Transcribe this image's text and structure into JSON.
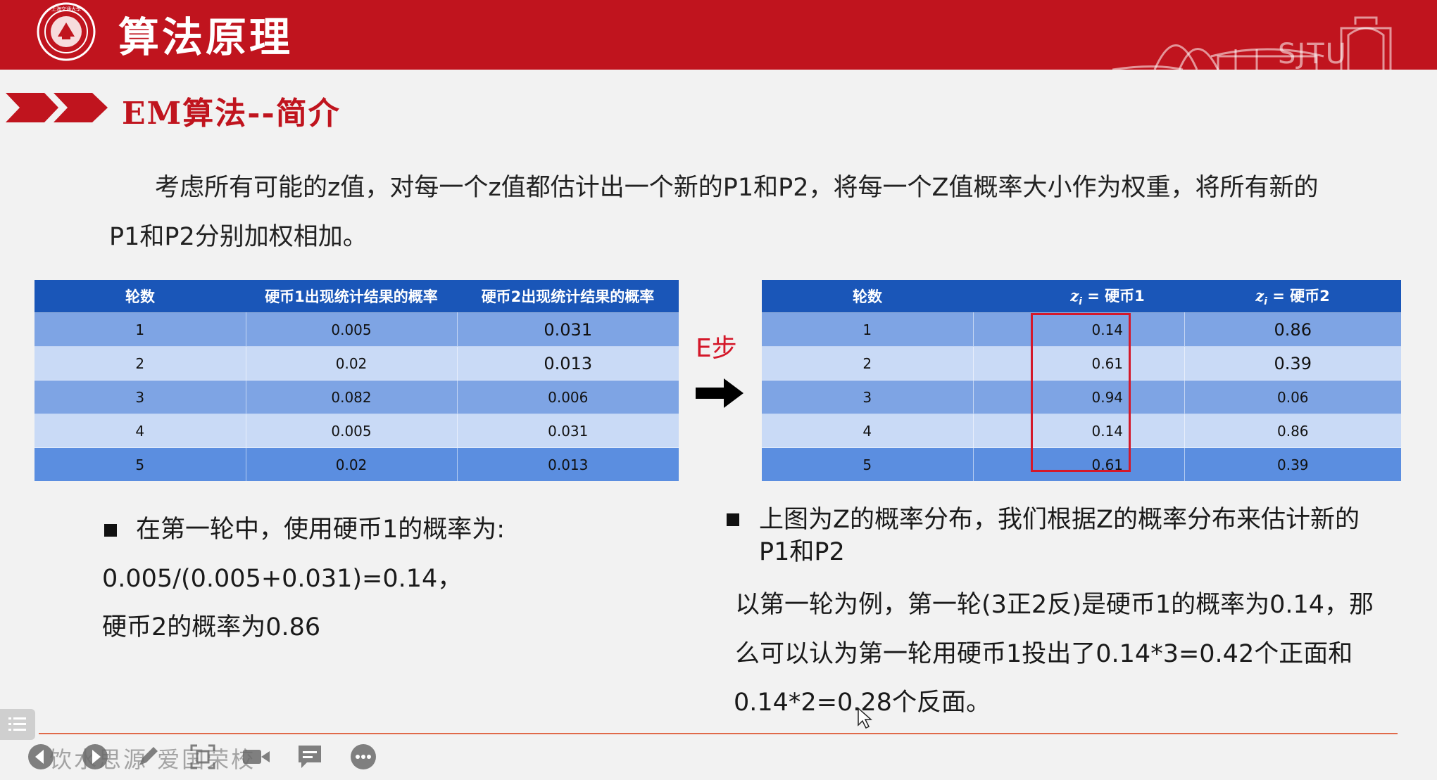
{
  "header": {
    "title": "算法原理",
    "logo_text": "上海交通大学",
    "brand_mark": "SJTU",
    "color": "#c0141e"
  },
  "section": {
    "title": "EM算法--简介"
  },
  "intro": {
    "text": "考虑所有可能的z值，对每一个z值都估计出一个新的P1和P2，将每一个Z值概率大小作为权重，将所有新的P1和P2分别加权相加。"
  },
  "table_left": {
    "headers": [
      "轮数",
      "硬币1出现统计结果的概率",
      "硬币2出现统计结果的概率"
    ],
    "rows": [
      [
        "1",
        "0.005",
        "0.031"
      ],
      [
        "2",
        "0.02",
        "0.013"
      ],
      [
        "3",
        "0.082",
        "0.006"
      ],
      [
        "4",
        "0.005",
        "0.031"
      ],
      [
        "5",
        "0.02",
        "0.013"
      ]
    ]
  },
  "estep": {
    "label": "E步",
    "icon": "right-arrow-icon"
  },
  "table_right": {
    "headers": [
      "轮数",
      "",
      "zi = 硬币1",
      "zi = 硬币2"
    ],
    "header_z1_var": "z",
    "header_z1_sub": "i",
    "header_z1_rest": " = 硬币1",
    "header_z2_var": "z",
    "header_z2_sub": "i",
    "header_z2_rest": " = 硬币2",
    "rows": [
      [
        "1",
        "",
        "0.14",
        "0.86"
      ],
      [
        "2",
        "",
        "0.61",
        "0.39"
      ],
      [
        "3",
        "",
        "0.94",
        "0.06"
      ],
      [
        "4",
        "",
        "0.14",
        "0.86"
      ],
      [
        "5",
        "",
        "0.61",
        "0.39"
      ]
    ],
    "highlight_color": "#d4182a"
  },
  "left_notes": {
    "line1": "在第一轮中，使用硬币1的概率为:",
    "line2": "0.005/(0.005+0.031)=0.14，",
    "line3": "硬币2的概率为0.86"
  },
  "right_notes": {
    "bullet_line1": "上图为Z的概率分布，我们根据Z的概率分布来估计新的",
    "bullet_line2": "P1和P2",
    "line3": "以第一轮为例，第一轮(3正2反)是硬币1的概率为0.14，那",
    "line4": "么可以认为第一轮用硬币1投出了0.14*3=0.42个正面和",
    "line5": "0.14*2=0.28个反面。"
  },
  "footer": {
    "watermark": "饮水思源  爱国荣校",
    "icons": [
      "menu-icon",
      "prev-icon",
      "next-icon",
      "pen-icon",
      "screenshot-icon",
      "camera-icon",
      "comment-icon",
      "more-icon"
    ]
  }
}
